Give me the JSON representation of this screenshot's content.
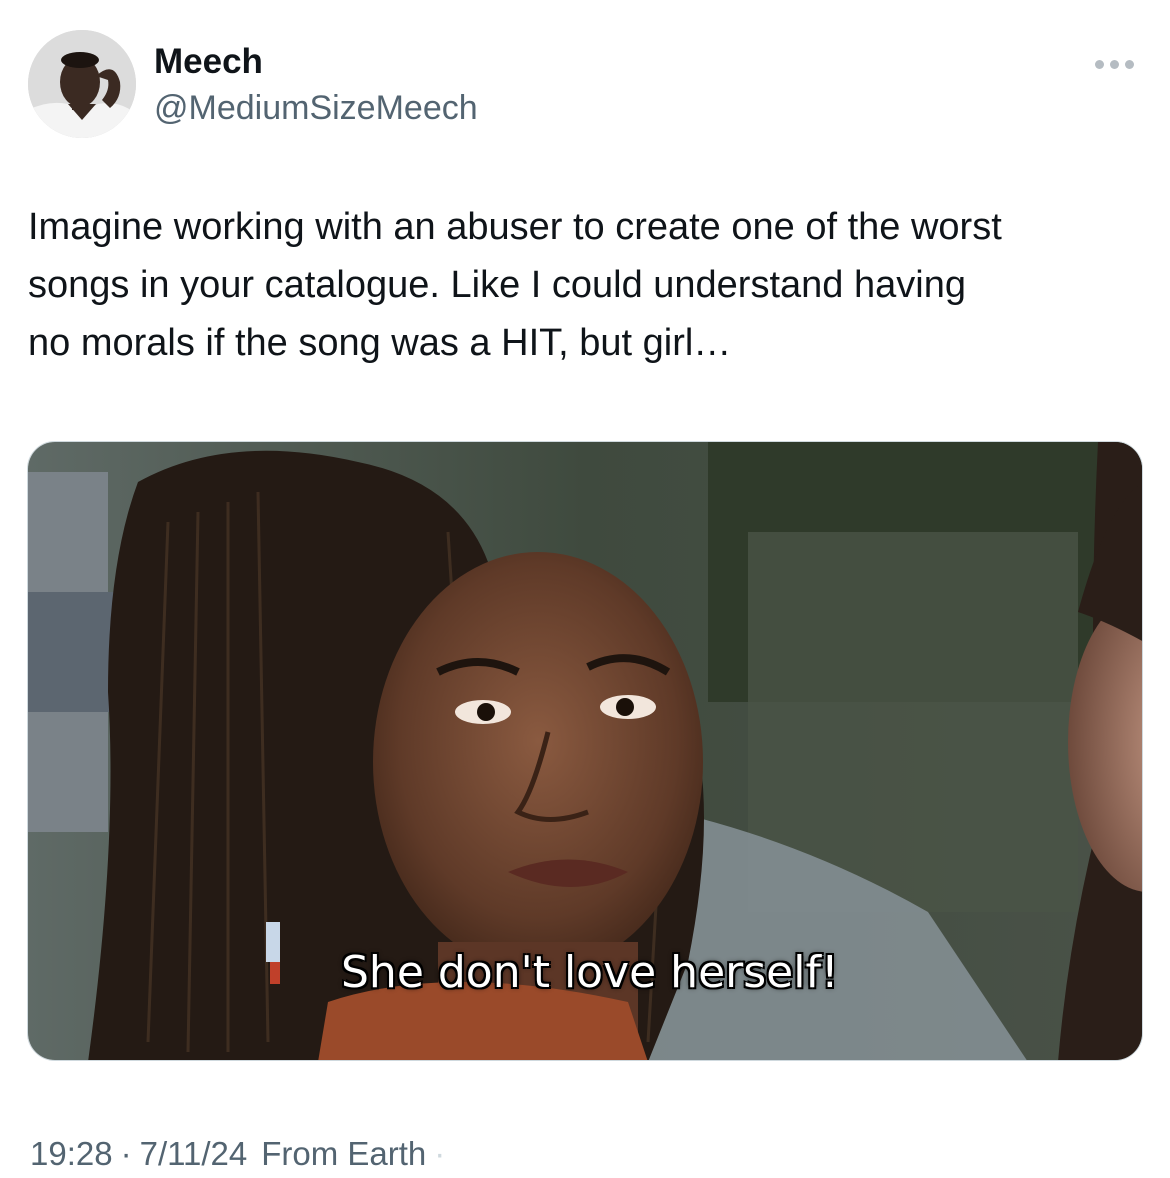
{
  "author": {
    "display_name": "Meech",
    "handle": "@MediumSizeMeech"
  },
  "tweet": {
    "text": "Imagine working with an abuser to create one of the worst\nsongs in your catalogue. Like I could understand having\nno morals if the song was a HIT, but girl…"
  },
  "media": {
    "caption": "She don't love herself!"
  },
  "meta": {
    "time": "19:28",
    "date": "7/11/24",
    "source": "From Earth",
    "separator": "·"
  },
  "icons": {
    "more": "more-dots-icon"
  },
  "colors": {
    "text": "#0f1419",
    "secondary": "#536471",
    "border": "#cfd9de"
  }
}
